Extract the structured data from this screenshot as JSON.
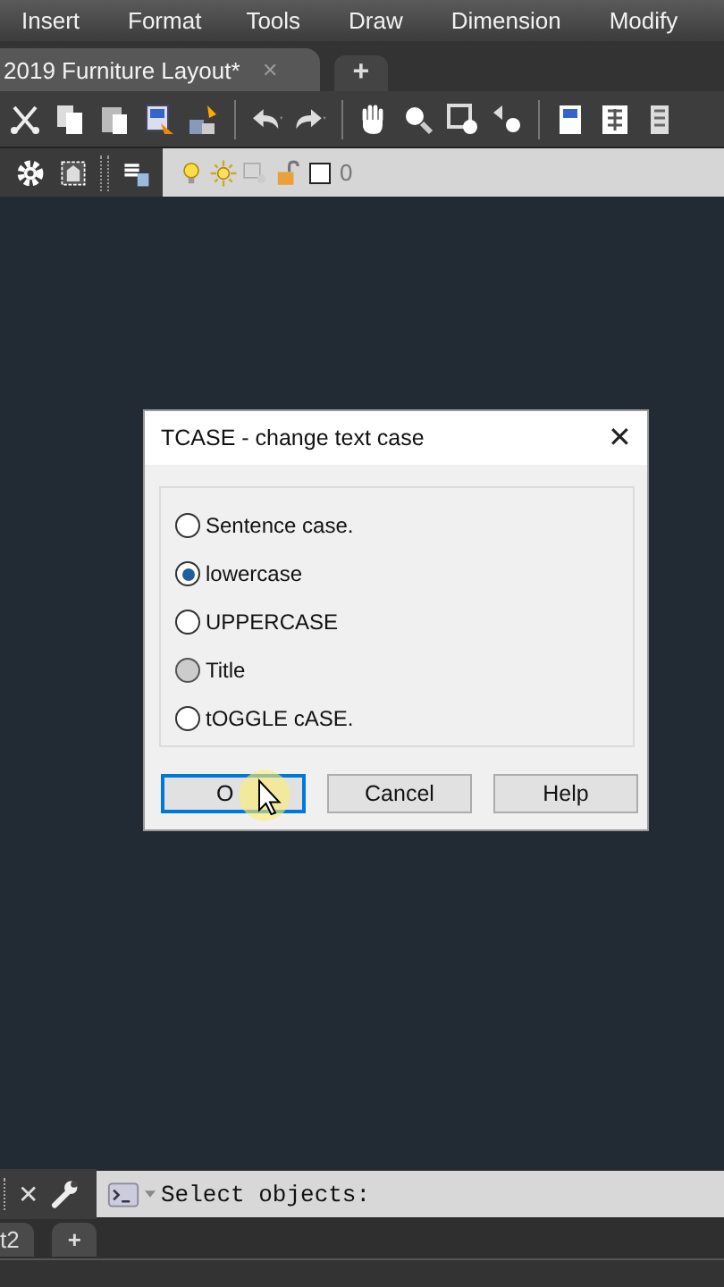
{
  "menu": [
    "Insert",
    "Format",
    "Tools",
    "Draw",
    "Dimension",
    "Modify"
  ],
  "file_tabs": [
    {
      "label": "2019 Furniture Layout*",
      "close": "✕",
      "selected": true
    },
    {
      "label": "+",
      "selected": false
    }
  ],
  "layer_toolbar": {
    "layer_name": "0"
  },
  "dialog": {
    "title": "TCASE - change text case",
    "close": "✕",
    "options": [
      {
        "label": "Sentence case.",
        "selected": false,
        "pressed": false
      },
      {
        "label": "lowercase",
        "selected": true,
        "pressed": false
      },
      {
        "label": "UPPERCASE",
        "selected": false,
        "pressed": false
      },
      {
        "label": "Title",
        "selected": false,
        "pressed": true
      },
      {
        "label": "tOGGLE cASE.",
        "selected": false,
        "pressed": false
      }
    ],
    "buttons": [
      {
        "label": "O",
        "default": true
      },
      {
        "label": "Cancel",
        "default": false
      },
      {
        "label": "Help",
        "default": false
      }
    ]
  },
  "command_line": {
    "close": "✕",
    "prompt": "Select objects:"
  },
  "layout_tabs": [
    {
      "label": "t2"
    },
    {
      "label": "+"
    }
  ]
}
